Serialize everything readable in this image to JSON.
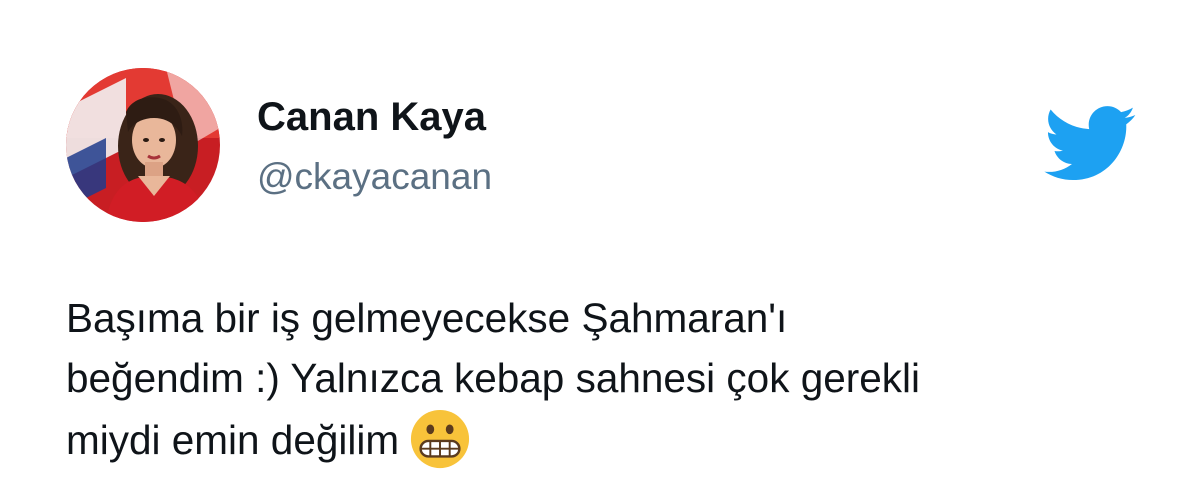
{
  "tweet": {
    "display_name": "Canan Kaya",
    "handle": "@ckayacanan",
    "text_lines": [
      "Başıma bir iş gelmeyecekse Şahmaran'ı",
      "beğendim :) Yalnızca kebap sahnesi çok gerekli",
      "miydi emin değilim"
    ],
    "emoji": "grimacing-face"
  },
  "icons": {
    "brand_logo": "twitter-bird-icon",
    "avatar": "profile-photo"
  },
  "colors": {
    "text": "#0f1419",
    "handle": "#5b7083",
    "twitter_blue": "#1da1f2",
    "emoji_yellow": "#f8c33a"
  }
}
